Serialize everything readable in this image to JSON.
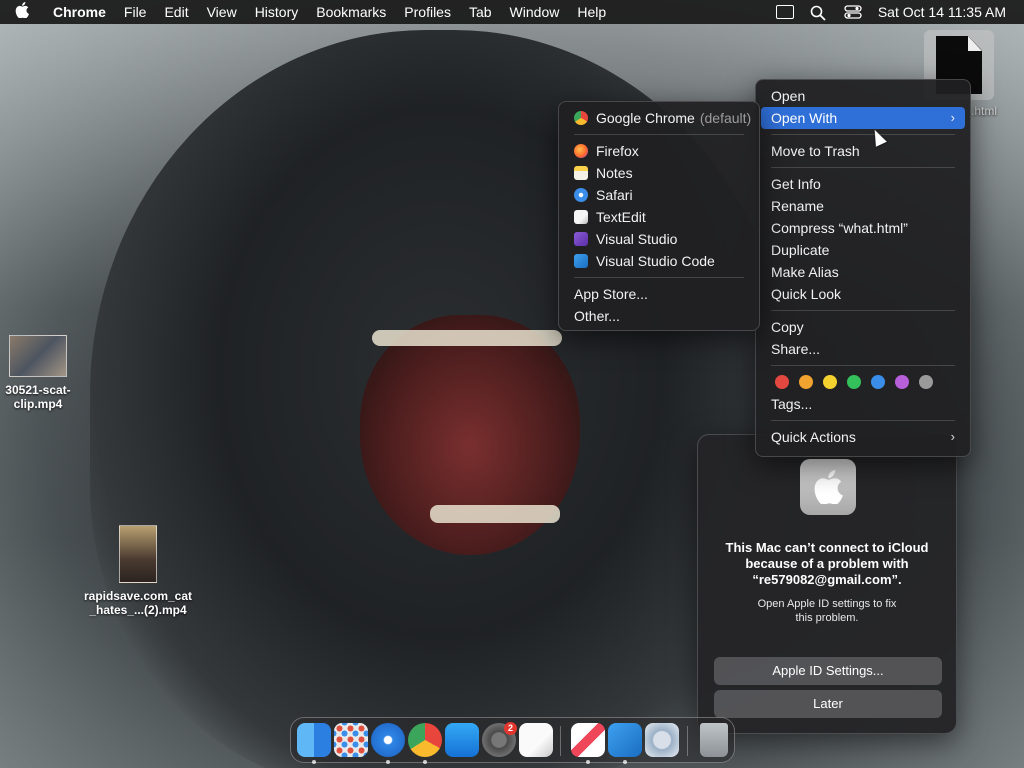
{
  "menubar": {
    "apple_glyph": "",
    "items": [
      "Chrome",
      "File",
      "Edit",
      "View",
      "History",
      "Bookmarks",
      "Profiles",
      "Tab",
      "Window",
      "Help"
    ],
    "datetime": "Sat Oct 14  11:35 AM"
  },
  "desktop": {
    "file_top_right": {
      "label": ".html"
    },
    "video1": {
      "label_line1": "30521-scat-",
      "label_line2": "clip.mp4"
    },
    "video2": {
      "label_line1": "rapidsave.com_cat",
      "label_line2": "_hates_...(2).mp4"
    }
  },
  "context_menu": {
    "open": "Open",
    "open_with": "Open With",
    "move_to_trash": "Move to Trash",
    "get_info": "Get Info",
    "rename": "Rename",
    "compress": "Compress “what.html”",
    "duplicate": "Duplicate",
    "make_alias": "Make Alias",
    "quick_look": "Quick Look",
    "copy": "Copy",
    "share": "Share...",
    "tags_label": "Tags...",
    "quick_actions": "Quick Actions",
    "tag_colors": [
      "#e2483f",
      "#f0a32f",
      "#f5d130",
      "#34c05a",
      "#3a8de8",
      "#b65fd9",
      "#9a9a9a"
    ]
  },
  "open_with_menu": {
    "default_app": "Google Chrome",
    "default_suffix": "(default)",
    "apps": [
      "Firefox",
      "Notes",
      "Safari",
      "TextEdit",
      "Visual Studio",
      "Visual Studio Code"
    ],
    "app_store": "App Store...",
    "other": "Other..."
  },
  "notification": {
    "title_line1": "This Mac can’t connect to iCloud",
    "title_line2": "because of a problem with",
    "title_line3": "“re579082@gmail.com”.",
    "msg_line1": "Open Apple ID settings to fix",
    "msg_line2": "this problem.",
    "primary_button": "Apple ID Settings...",
    "secondary_button": "Later"
  },
  "dock": {
    "settings_badge": "2"
  }
}
